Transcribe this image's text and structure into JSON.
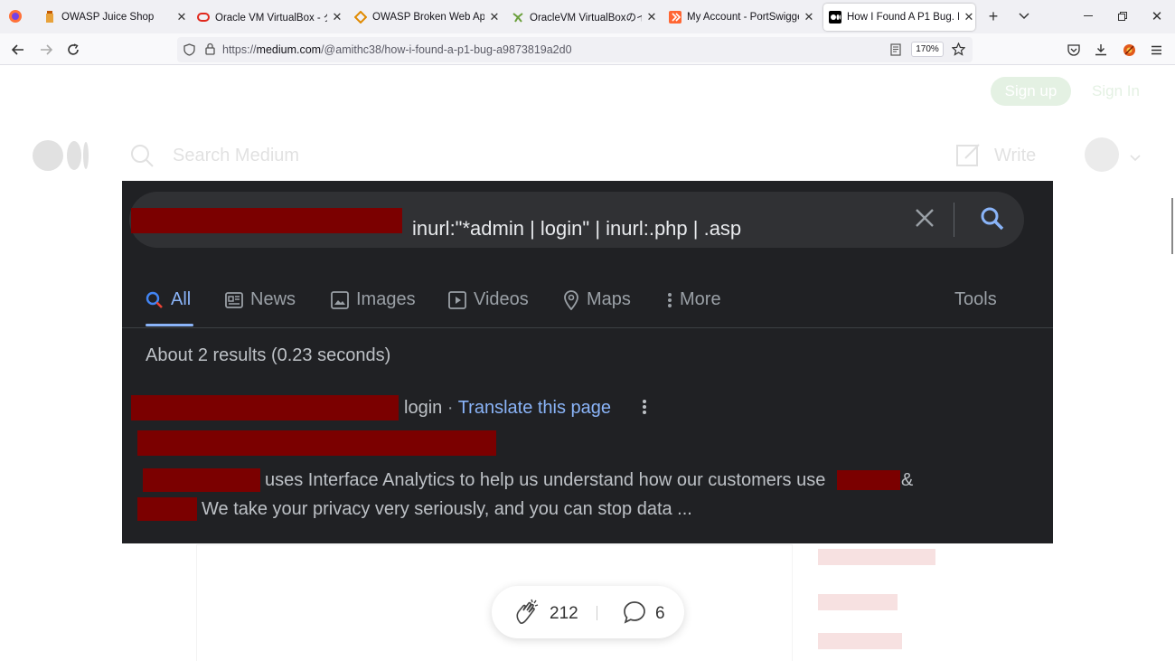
{
  "tabs": [
    {
      "title": "OWASP Juice Shop",
      "favicon": "juice-icon"
    },
    {
      "title": "Oracle VM VirtualBox - ダウン",
      "favicon": "oracle-icon"
    },
    {
      "title": "OWASP Broken Web Applic",
      "favicon": "owasp-icon"
    },
    {
      "title": "OracleVM VirtualBoxのインス",
      "favicon": "vbox-icon"
    },
    {
      "title": "My Account - PortSwigger",
      "favicon": "portswigger-icon"
    },
    {
      "title": "How I Found A P1 Bug. Hi, |",
      "favicon": "medium-icon",
      "active": true
    }
  ],
  "url": {
    "prefix": "https://",
    "host": "medium.com",
    "path": "/@amithc38/how-i-found-a-p1-bug-a9873819a2d0"
  },
  "zoom": "170%",
  "medium": {
    "signup": "Sign up",
    "signin": "Sign In",
    "search_placeholder": "Search Medium",
    "write": "Write"
  },
  "google": {
    "query": "inurl:\"*admin | login\" | inurl:.php | .asp",
    "tabs": [
      "All",
      "News",
      "Images",
      "Videos",
      "Maps",
      "More"
    ],
    "tools": "Tools",
    "stats": "About 2 results (0.23 seconds)",
    "result_title": "login",
    "translate": "Translate this page",
    "snippet_line1": "uses Interface Analytics to help us understand how our customers use",
    "snippet_amp": "&",
    "snippet_line2": "We take your privacy very seriously, and you can stop data ..."
  },
  "claps": "212",
  "comments": "6",
  "colors": {
    "google_bg": "#202124",
    "redaction": "#7b0000",
    "link": "#8ab4f8",
    "accent": "#1a8917"
  }
}
